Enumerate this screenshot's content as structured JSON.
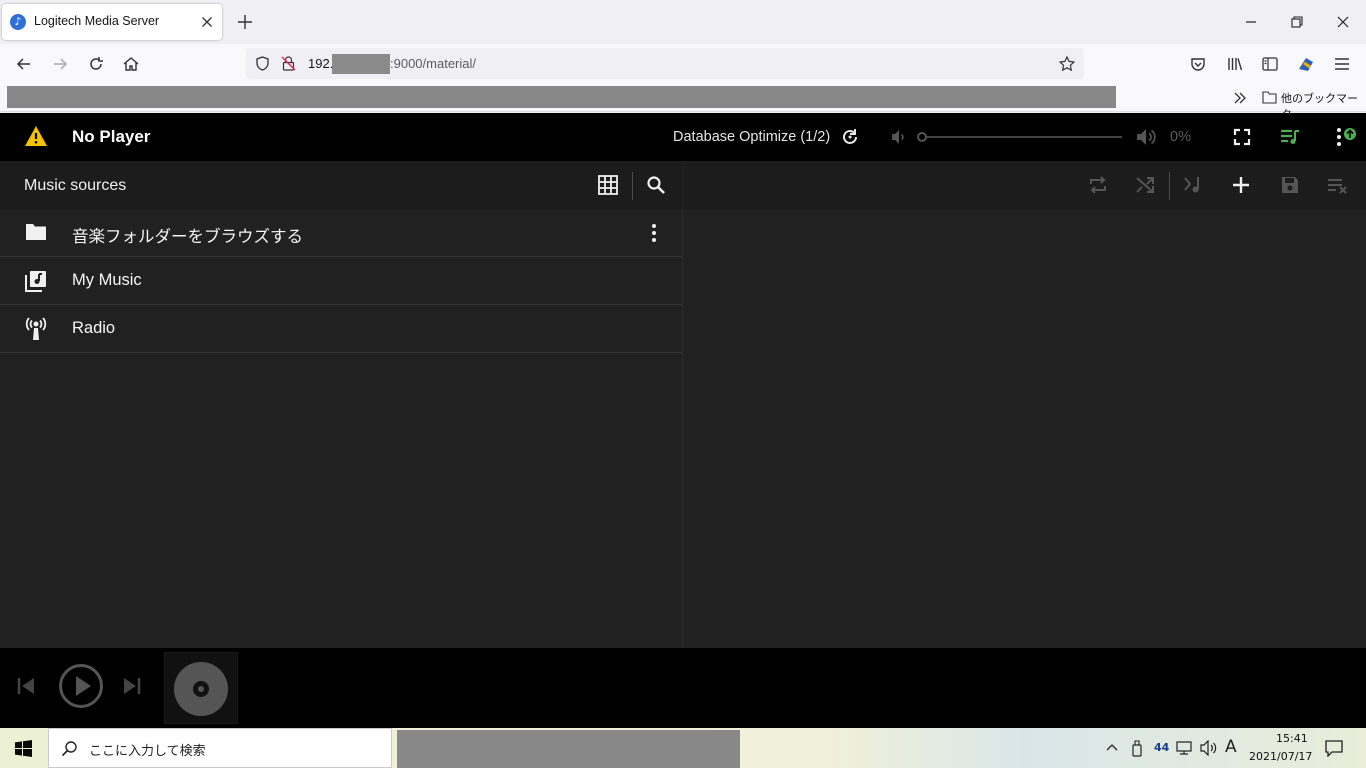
{
  "browser": {
    "tab_title": "Logitech Media Server",
    "url_prefix": "192.",
    "url_suffix": ":9000/material/",
    "bookmarks_other": "他のブックマーク"
  },
  "toolbar": {
    "player": "No Player",
    "status": "Database Optimize (1/2)",
    "volume": "0%"
  },
  "browse": {
    "title": "Music sources",
    "items": [
      {
        "label": "音楽フォルダーをブラウズする",
        "icon": "folder-icon"
      },
      {
        "label": "My Music",
        "icon": "library-music-icon"
      },
      {
        "label": "Radio",
        "icon": "radio-tower-icon"
      }
    ]
  },
  "taskbar": {
    "search_placeholder": "ここに入力して検索",
    "tray_count": "44",
    "ime": "A",
    "time": "15:41",
    "date": "2021/07/17"
  },
  "colors": {
    "app_bg": "#212121",
    "toolbar_bg": "#000000",
    "warning": "#f4c300",
    "accent_green": "#4caf50"
  }
}
